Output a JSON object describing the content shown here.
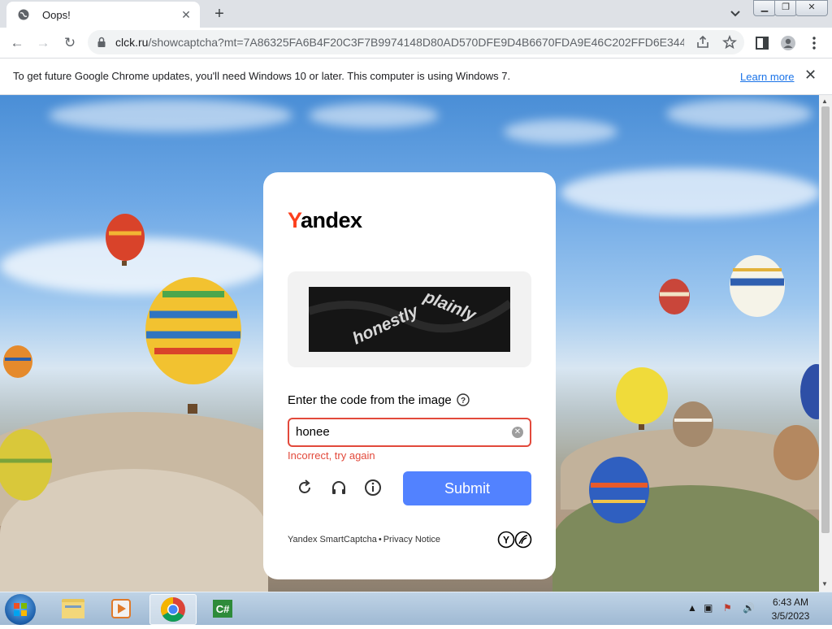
{
  "browser": {
    "tab_title": "Oops!",
    "new_tab_symbol": "+",
    "url_domain": "clck.ru",
    "url_rest": "/showcaptcha?mt=7A86325FA6B4F20C3F7B9974148D80AD570DFE9D4B6670FDA9E46C202FFD6E344BD0...",
    "icons": [
      "back-icon",
      "forward-icon",
      "reload-icon",
      "lock-icon",
      "share-icon",
      "star-icon",
      "side-panel-icon",
      "profile-icon",
      "menu-icon"
    ]
  },
  "infobar": {
    "message": "To get future Google Chrome updates, you'll need Windows 10 or later. This computer is using Windows 7.",
    "link": "Learn more"
  },
  "captcha": {
    "logo_first": "Y",
    "logo_rest": "andex",
    "image_text_1": "honestly",
    "image_text_2": "plainly",
    "label": "Enter the code from the image",
    "input_value": "honee",
    "error": "Incorrect, try again",
    "submit": "Submit",
    "footer_product": "Yandex SmartCaptcha",
    "footer_separator": "•",
    "footer_privacy": "Privacy Notice",
    "colors": {
      "accent": "#5282ff",
      "error": "#e2493b",
      "brand_red": "#fc3f1d"
    }
  },
  "taskbar": {
    "time": "6:43 AM",
    "date": "3/5/2023",
    "apps": [
      "file-explorer",
      "media-player",
      "chrome",
      "csharp-editor"
    ]
  }
}
